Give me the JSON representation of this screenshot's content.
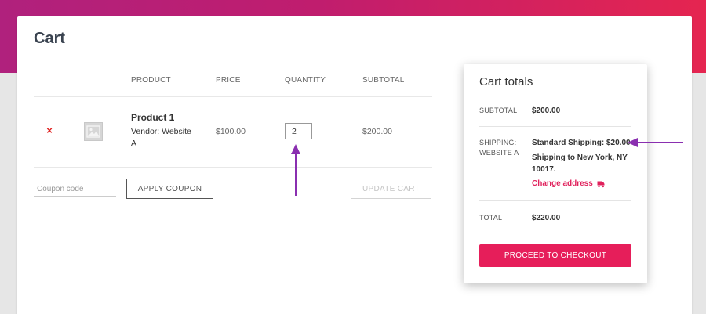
{
  "page": {
    "title": "Cart"
  },
  "cart_table": {
    "headers": {
      "product": "PRODUCT",
      "price": "PRICE",
      "quantity": "QUANTITY",
      "subtotal": "SUBTOTAL"
    },
    "rows": [
      {
        "remove_symbol": "×",
        "thumbnail_icon": "image-placeholder-icon",
        "product_name": "Product 1",
        "vendor_label": "Vendor:",
        "vendor_name": "Website A",
        "price": "$100.00",
        "quantity": "2",
        "subtotal": "$200.00"
      }
    ]
  },
  "actions": {
    "coupon_placeholder": "Coupon code",
    "apply_coupon_label": "APPLY COUPON",
    "update_cart_label": "UPDATE CART"
  },
  "totals": {
    "title": "Cart totals",
    "subtotal_label": "SUBTOTAL",
    "subtotal_value": "$200.00",
    "shipping_label": "SHIPPING: WEBSITE A",
    "shipping_method": "Standard Shipping: $20.00",
    "shipping_destination": "Shipping to New York, NY 10017.",
    "change_address_label": "Change address",
    "change_address_icon": "truck-icon",
    "total_label": "TOTAL",
    "total_value": "$220.00",
    "checkout_label": "PROCEED TO CHECKOUT"
  },
  "colors": {
    "brand_gradient_start": "#b0217d",
    "brand_gradient_end": "#e52550",
    "accent": "#e61e5a",
    "remove": "#e0201f",
    "annotation_arrow": "#8a2fb0"
  }
}
